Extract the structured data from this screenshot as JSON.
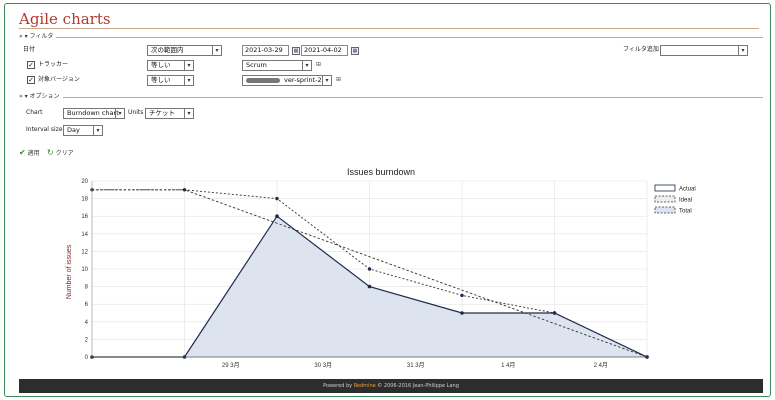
{
  "page": {
    "title": "Agile charts"
  },
  "filters": {
    "legend": "フィルタ",
    "date": {
      "label": "日付",
      "operator": "次の範囲内",
      "from": "2021-03-29",
      "to": "2021-04-02"
    },
    "tracker": {
      "label": "トラッカー",
      "operator": "等しい",
      "value": "Scrum"
    },
    "version": {
      "label": "対象バージョン",
      "operator": "等しい",
      "value": "ver-sprint-2"
    },
    "add_filter": {
      "label": "フィルタ追加",
      "value": ""
    }
  },
  "options": {
    "legend": "オプション",
    "chart": {
      "label": "Chart",
      "value": "Burndown chart"
    },
    "units": {
      "label": "Units",
      "value": "チケット"
    },
    "interval": {
      "label": "Interval size",
      "value": "Day"
    }
  },
  "actions": {
    "apply": "適用",
    "clear": "クリア"
  },
  "icons": {
    "apply": "check-icon",
    "clear": "refresh-icon",
    "calendar": "calendar-icon",
    "plus": "plus-icon"
  },
  "colors": {
    "title": "#b03a2e",
    "actual": "#1f2a4a",
    "total_fill": "#dde4ef"
  },
  "chart_data": {
    "type": "area",
    "title": "Issues burndown",
    "ylabel": "Number of issues",
    "xlabel": "",
    "ylim": [
      0,
      20
    ],
    "yticks": [
      0,
      2,
      4,
      6,
      8,
      10,
      12,
      14,
      16,
      18,
      20
    ],
    "xtick_labels": [
      "29 3月",
      "30 3月",
      "31 3月",
      "1 4月",
      "2 4月"
    ],
    "legend_placement": "top-right",
    "series": [
      {
        "name": "Actual",
        "values": [
          0,
          0,
          16,
          8,
          5,
          5,
          0
        ]
      },
      {
        "name": "Ideal",
        "values": [
          19,
          19,
          18,
          10,
          7,
          5,
          0
        ]
      },
      {
        "name": "Total",
        "values": [
          19,
          19,
          15.2,
          11.4,
          7.6,
          3.8,
          0
        ]
      }
    ]
  },
  "footer": {
    "prefix": "Powered by ",
    "brand": "Redmine",
    "suffix": " © 2006-2016 Jean-Philippe Lang"
  }
}
